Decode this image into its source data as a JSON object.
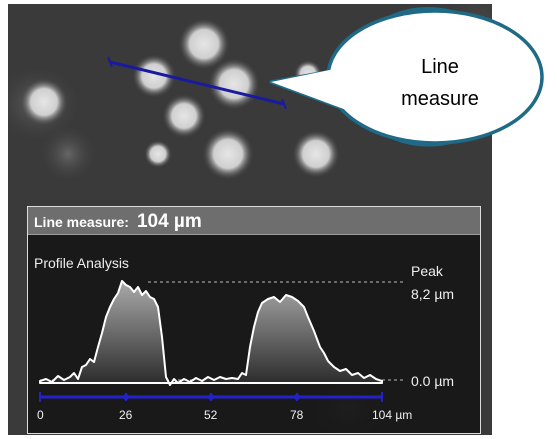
{
  "callout": {
    "line1": "Line",
    "line2": "measure"
  },
  "measure_panel": {
    "label": "Line measure:",
    "value": "104 µm",
    "profile_title": "Profile Analysis",
    "peak_label": "Peak",
    "peak_value": "8,2 µm",
    "zero_value": "0.0 µm",
    "axis_ticks": [
      "0",
      "26",
      "52",
      "78",
      "104 µm"
    ]
  },
  "colors": {
    "measure_line": "#1a1aa0",
    "axis_blue": "#2222cc",
    "callout_border": "#1e6a87"
  }
}
